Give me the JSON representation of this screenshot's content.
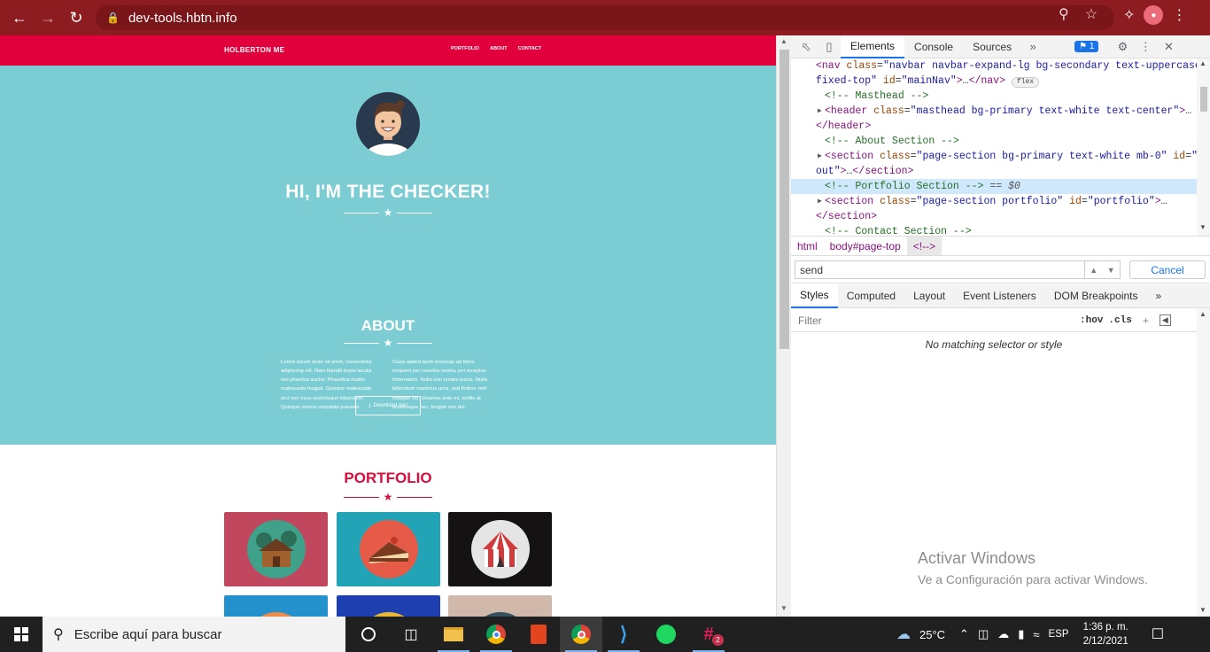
{
  "browser": {
    "url": "dev-tools.hbtn.info"
  },
  "site": {
    "brand": "HOLBERTON ME",
    "nav": [
      "PORTFOLIO",
      "ABOUT",
      "CONTACT"
    ],
    "hero_title": "HI, I'M THE CHECKER!",
    "about_title": "ABOUT",
    "about_left": "Lorem ipsum dolor sit amet, consectetur adipiscing elit. Nam blandit turpis iaculis nisl pharetra auctor. Phasellus mattis malesuada feugiat. Quisque malesuada orci non risus scelerisque bibendum. Quisque viverra vulputate posuere.",
    "about_right": "Class aptent taciti sociosqu ad litora torquent per conubia nostra, per inceptos himenaeos. Nulla non ornare purus. Nulla bibendum maximus urna, sed finibus velit tristique vel. Vivamus ante mi, mollis at scelerisque nec, feugiat non dui.",
    "download_label": "Download me!",
    "portfolio_title": "PORTFOLIO",
    "colors": {
      "primary": "#e2003c",
      "masthead": "#7bcdd3",
      "portfolio_accent": "#d70f3f"
    },
    "tiles": [
      {
        "name": "cabin",
        "bg": "#c0475d"
      },
      {
        "name": "cake",
        "bg": "#22a4b6"
      },
      {
        "name": "circus",
        "bg": "#141212"
      },
      {
        "name": "game",
        "bg": "#2291cc"
      },
      {
        "name": "safe",
        "bg": "#1d3fb0"
      },
      {
        "name": "submarine",
        "bg": "#d0b9aa"
      }
    ]
  },
  "devtools": {
    "tabs": [
      "Elements",
      "Console",
      "Sources"
    ],
    "issues_count": "1",
    "dom_lines": [
      {
        "html": "<span class=\"tag\">&lt;nav</span> <span class=\"attr\">class</span>=<span class=\"val\">\"navbar navbar-expand-lg bg-secondary text-uppercase</span>"
      },
      {
        "html": "<span class=\"val\">fixed-top\"</span> <span class=\"attr\">id</span>=<span class=\"val\">\"mainNav\"</span><span class=\"tag\">&gt;</span>…<span class=\"tag\">&lt;/nav&gt;</span> <span class=\"flexbadge\">flex</span>",
        "indent": 0
      },
      {
        "html": "<span class=\"comm\">&lt;!-- Masthead --&gt;</span>",
        "indent": 10
      },
      {
        "html": "<span class=\"tag\">&lt;header</span> <span class=\"attr\">class</span>=<span class=\"val\">\"masthead bg-primary text-white text-center\"</span><span class=\"tag\">&gt;</span>…",
        "tri": true,
        "indent": 10
      },
      {
        "html": "<span class=\"tag\">&lt;/header&gt;</span>",
        "indent": 0
      },
      {
        "html": "<span class=\"comm\">&lt;!-- About Section --&gt;</span>",
        "indent": 10
      },
      {
        "html": "<span class=\"tag\">&lt;section</span> <span class=\"attr\">class</span>=<span class=\"val\">\"page-section bg-primary text-white mb-0\"</span> <span class=\"attr\">id</span>=<span class=\"val\">\"ab</span>",
        "tri": true,
        "indent": 10
      },
      {
        "html": "<span class=\"val\">out\"</span><span class=\"tag\">&gt;</span>…<span class=\"tag\">&lt;/section&gt;</span>",
        "indent": 0
      },
      {
        "html": "<span class=\"comm\">&lt;!-- Portfolio Section --&gt;</span> <span style=\"color:#555\">== <i>$0</i></span>",
        "indent": 10,
        "sel": true
      },
      {
        "html": "<span class=\"tag\">&lt;section</span> <span class=\"attr\">class</span>=<span class=\"val\">\"page-section portfolio\"</span> <span class=\"attr\">id</span>=<span class=\"val\">\"portfolio\"</span><span class=\"tag\">&gt;</span>…",
        "tri": true,
        "indent": 10
      },
      {
        "html": "<span class=\"tag\">&lt;/section&gt;</span>",
        "indent": 0
      },
      {
        "html": "<span class=\"comm\">&lt;!-- Contact Section --&gt;</span>",
        "indent": 10
      }
    ],
    "crumbs": [
      "html",
      "body#page-top",
      "<!-->"
    ],
    "search_value": "send",
    "cancel_label": "Cancel",
    "style_tabs": [
      "Styles",
      "Computed",
      "Layout",
      "Event Listeners",
      "DOM Breakpoints"
    ],
    "filter_placeholder": "Filter",
    "hov": ":hov",
    "cls": ".cls",
    "no_match": "No matching selector or style"
  },
  "watermark": {
    "line1": "Activar Windows",
    "line2": "Ve a Configuración para activar Windows."
  },
  "taskbar": {
    "search_placeholder": "Escribe aquí para buscar",
    "temperature": "25°C",
    "language": "ESP",
    "time": "1:36 p. m.",
    "date": "2/12/2021",
    "slack_badge": "2"
  }
}
